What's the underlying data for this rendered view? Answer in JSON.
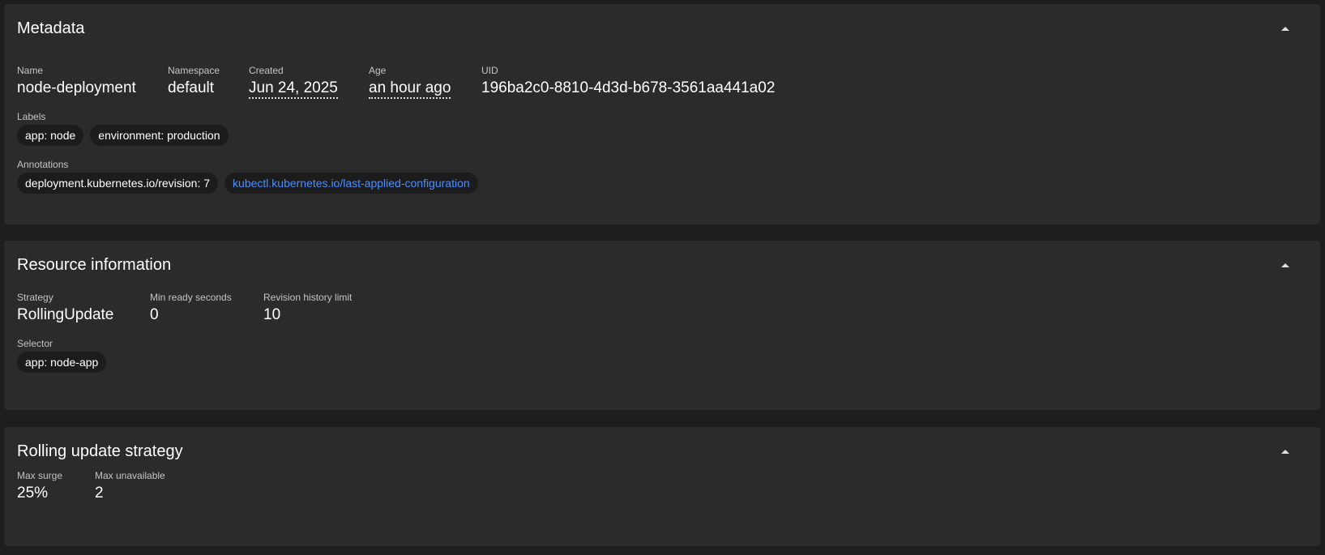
{
  "metadata": {
    "title": "Metadata",
    "fields": {
      "name": {
        "label": "Name",
        "value": "node-deployment"
      },
      "namespace": {
        "label": "Namespace",
        "value": "default"
      },
      "created": {
        "label": "Created",
        "value": "Jun 24, 2025"
      },
      "age": {
        "label": "Age",
        "value": "an hour ago"
      },
      "uid": {
        "label": "UID",
        "value": "196ba2c0-8810-4d3d-b678-3561aa441a02"
      }
    },
    "labels": {
      "label": "Labels",
      "items": [
        "app: node",
        "environment: production"
      ]
    },
    "annotations": {
      "label": "Annotations",
      "items": [
        "deployment.kubernetes.io/revision: 7"
      ],
      "link": "kubectl.kubernetes.io/last-applied-configuration"
    }
  },
  "resource_info": {
    "title": "Resource information",
    "fields": {
      "strategy": {
        "label": "Strategy",
        "value": "RollingUpdate"
      },
      "min_ready": {
        "label": "Min ready seconds",
        "value": "0"
      },
      "revision_limit": {
        "label": "Revision history limit",
        "value": "10"
      }
    },
    "selector": {
      "label": "Selector",
      "items": [
        "app: node-app"
      ]
    }
  },
  "rolling_update": {
    "title": "Rolling update strategy",
    "fields": {
      "max_surge": {
        "label": "Max surge",
        "value": "25%"
      },
      "max_unavailable": {
        "label": "Max unavailable",
        "value": "2"
      }
    }
  },
  "icons": {
    "collapse": "chevron-up-icon"
  },
  "colors": {
    "background": "#1e1e1e",
    "card": "#2b2b2b",
    "chip": "#1c1c1c",
    "link": "#4c8dff"
  }
}
